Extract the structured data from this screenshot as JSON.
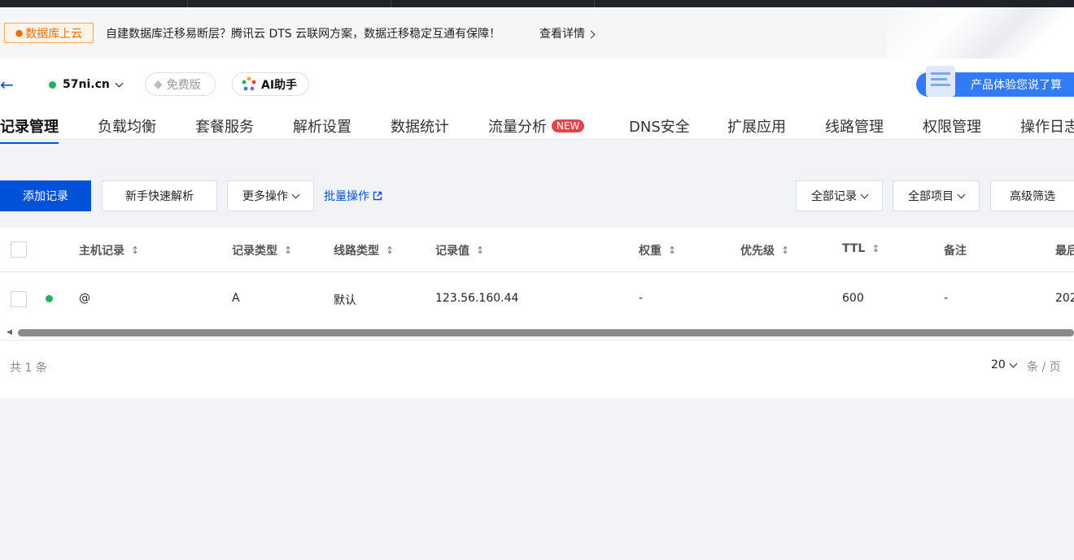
{
  "promo": {
    "tag": "数据库上云",
    "text": "自建数据库迁移易断层？腾讯云 DTS 云联网方案，数据迁移稳定互通有保障！",
    "link": "查看详情"
  },
  "header": {
    "back": "←",
    "domain": "57ni.cn",
    "plan": "免费版",
    "ai": "AI助手",
    "feedback": "产品体验您说了算"
  },
  "tabs": [
    {
      "label": "记录管理"
    },
    {
      "label": "负载均衡"
    },
    {
      "label": "套餐服务"
    },
    {
      "label": "解析设置"
    },
    {
      "label": "数据统计"
    },
    {
      "label": "流量分析",
      "badge": "NEW"
    },
    {
      "label": "DNS安全"
    },
    {
      "label": "扩展应用"
    },
    {
      "label": "线路管理"
    },
    {
      "label": "权限管理"
    },
    {
      "label": "操作日志"
    }
  ],
  "toolbar": {
    "add": "添加记录",
    "quick": "新手快速解析",
    "more": "更多操作",
    "batch": "批量操作",
    "all_records": "全部记录",
    "all_items": "全部项目",
    "advanced": "高级筛选"
  },
  "table": {
    "columns": [
      "主机记录",
      "记录类型",
      "线路类型",
      "记录值",
      "权重",
      "优先级",
      "TTL",
      "备注",
      "最后"
    ],
    "rows": [
      {
        "host": "@",
        "type": "A",
        "line": "默认",
        "value": "123.56.160.44",
        "weight": "-",
        "priority": "",
        "ttl": "600",
        "remark": "-",
        "last": "202"
      }
    ]
  },
  "pagination": {
    "total": "共 1 条",
    "size": "20",
    "unit": "条 / 页"
  },
  "colors": {
    "primary": "#0052d9",
    "status_green": "#22b35e",
    "badge_red": "#e54545",
    "promo_orange": "#ef6c00"
  }
}
